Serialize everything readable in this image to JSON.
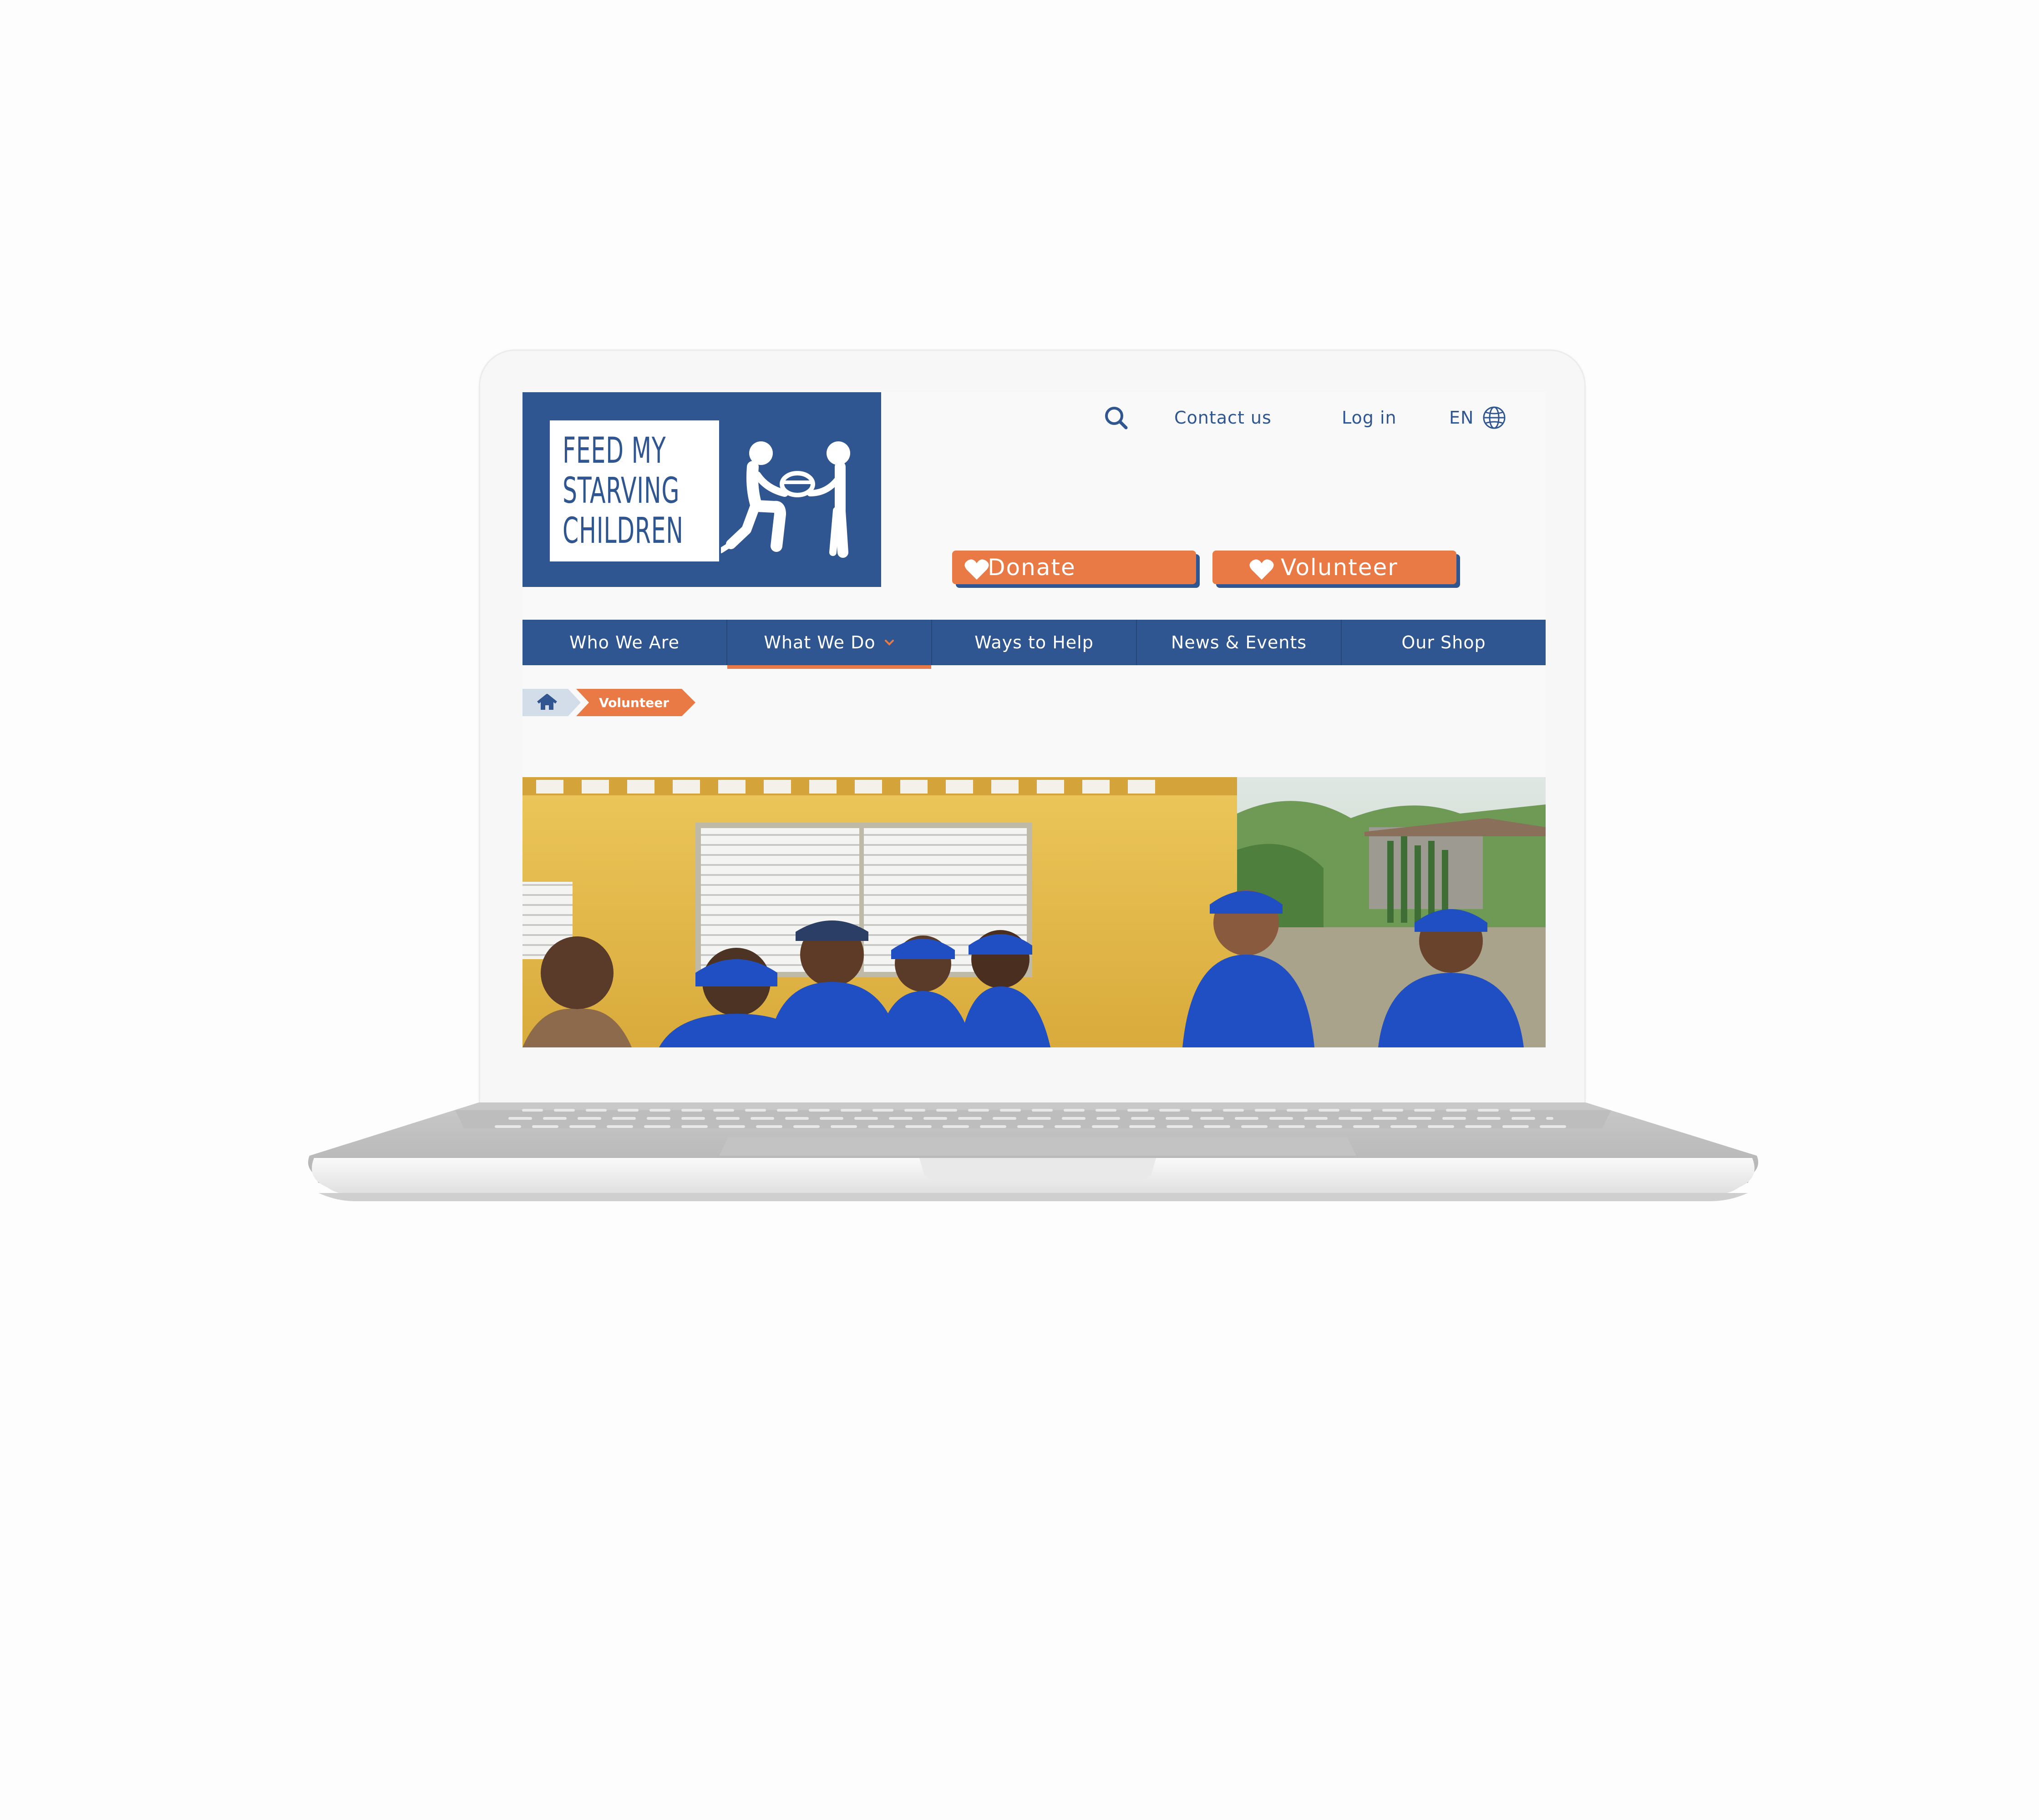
{
  "logo": {
    "lines": [
      "FEED MY",
      "STARVING",
      "CHILDREN"
    ]
  },
  "utility": {
    "search_icon": "search-icon",
    "contact": "Contact us",
    "login": "Log in",
    "language": "EN",
    "globe_icon": "globe-icon"
  },
  "cta": {
    "donate": "Donate",
    "volunteer": "Volunteer",
    "icon": "heart-icon"
  },
  "nav": {
    "items": [
      {
        "label": "Who We Are"
      },
      {
        "label": "What We Do",
        "active": true
      },
      {
        "label": "Ways to Help"
      },
      {
        "label": "News & Events"
      },
      {
        "label": "Our Shop"
      }
    ]
  },
  "breadcrumb": {
    "home_icon": "home-icon",
    "current": "Volunteer"
  },
  "colors": {
    "brand_blue": "#2f5690",
    "brand_orange": "#ea7a45",
    "background": "#f9f9fa"
  }
}
